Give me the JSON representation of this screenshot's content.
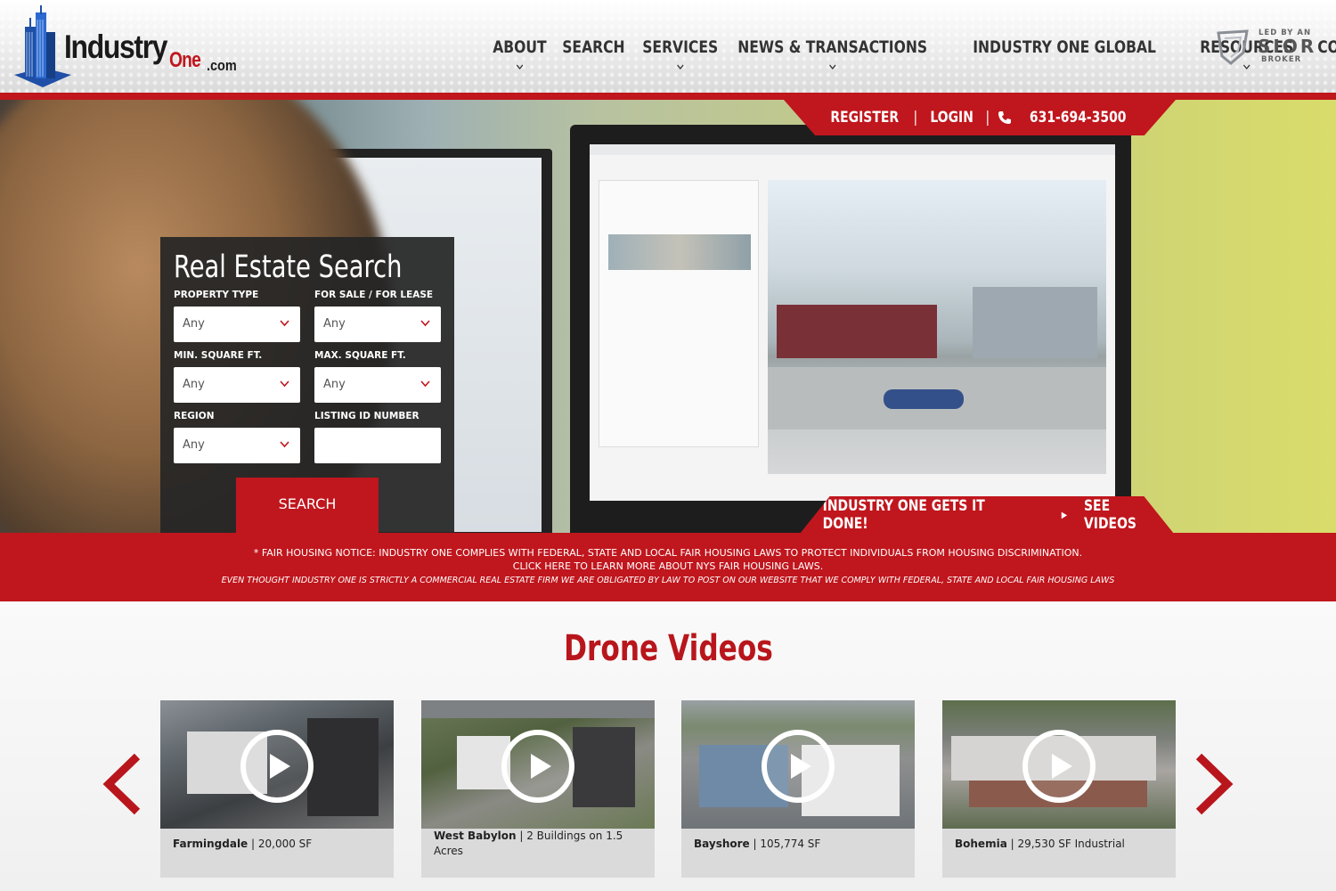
{
  "brand": {
    "logo_text_main": "Industry",
    "logo_text_one": "One",
    "logo_text_tld": ".com",
    "accent_color": "#c0161d"
  },
  "nav": {
    "items": [
      {
        "label": "ABOUT",
        "has_dropdown": true
      },
      {
        "label": "SEARCH",
        "has_dropdown": false
      },
      {
        "label": "SERVICES",
        "has_dropdown": true
      },
      {
        "label": "NEWS & TRANSACTIONS",
        "has_dropdown": true
      },
      {
        "label": "INDUSTRY ONE GLOBAL",
        "has_dropdown": false
      },
      {
        "label": "RESOURCES",
        "has_dropdown": true
      },
      {
        "label": "CONTACT",
        "has_dropdown": false
      }
    ]
  },
  "sior": {
    "line1": "LED BY AN",
    "line2": "SIOR",
    "line3": "BROKER"
  },
  "topbar": {
    "register": "REGISTER",
    "sep": "|",
    "login": "LOGIN",
    "phone": "631-694-3500",
    "phone_icon": "phone-icon"
  },
  "search": {
    "title": "Real Estate Search",
    "property_type_label": "PROPERTY TYPE",
    "property_type_value": "Any",
    "sale_lease_label": "FOR SALE / FOR LEASE",
    "sale_lease_value": "Any",
    "min_sqft_label": "MIN. SQUARE FT.",
    "min_sqft_value": "Any",
    "max_sqft_label": "MAX. SQUARE FT.",
    "max_sqft_value": "Any",
    "region_label": "REGION",
    "region_value": "Any",
    "listing_id_label": "LISTING ID NUMBER",
    "listing_id_value": "",
    "button": "SEARCH"
  },
  "videos_cta": {
    "text": "INDUSTRY ONE GETS IT DONE!",
    "link": "SEE VIDEOS"
  },
  "notice": {
    "line1": "* FAIR HOUSING NOTICE: INDUSTRY ONE COMPLIES WITH FEDERAL, STATE AND LOCAL FAIR HOUSING LAWS TO PROTECT INDIVIDUALS FROM HOUSING DISCRIMINATION.",
    "line2": "CLICK HERE TO LEARN MORE ABOUT NYS FAIR HOUSING LAWS.",
    "line3": "EVEN THOUGHT INDUSTRY ONE IS STRICTLY A COMMERCIAL REAL ESTATE FIRM WE ARE OBLIGATED BY LAW TO POST ON OUR WEBSITE THAT WE COMPLY WITH FEDERAL, STATE AND LOCAL FAIR HOUSING LAWS"
  },
  "drone": {
    "title": "Drone Videos",
    "cards": [
      {
        "place": "Farmingdale",
        "detail": " | 20,000 SF"
      },
      {
        "place": "West Babylon",
        "detail": " | 2 Buildings on 1.5 Acres"
      },
      {
        "place": "Bayshore",
        "detail": " | 105,774 SF"
      },
      {
        "place": "Bohemia",
        "detail": " | 29,530 SF Industrial"
      }
    ]
  }
}
